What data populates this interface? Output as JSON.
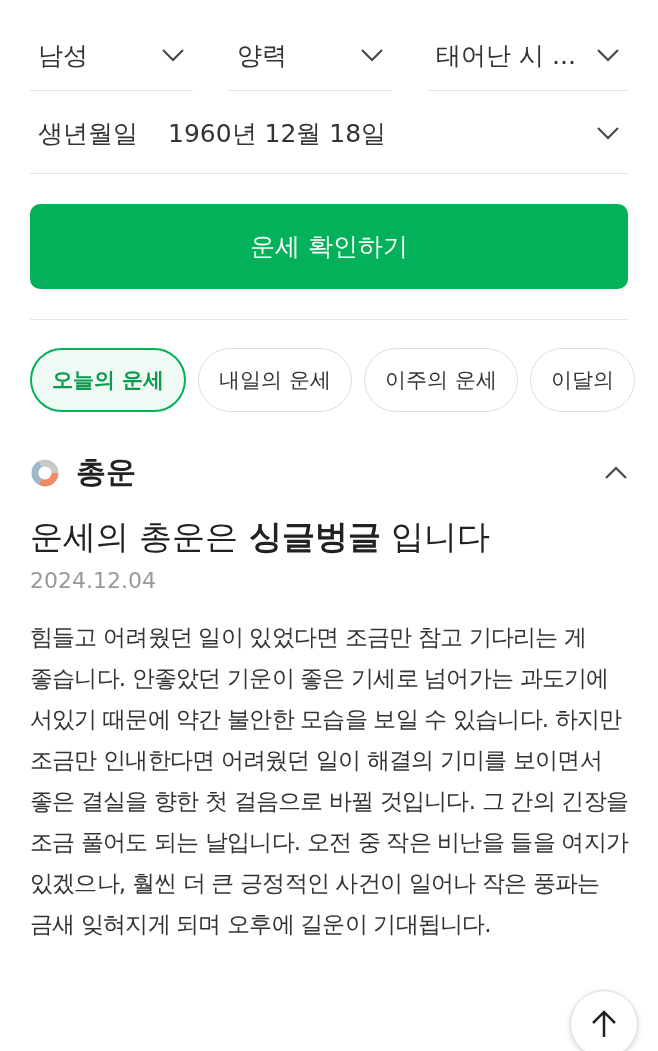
{
  "filters": [
    {
      "label": "남성"
    },
    {
      "label": "양력"
    },
    {
      "label": "태어난 시 ..."
    }
  ],
  "birth_date": {
    "label": "생년월일",
    "value": "1960년 12월 18일"
  },
  "submit_button": "운세 확인하기",
  "tabs": [
    {
      "label": "오늘의 운세",
      "selected": true
    },
    {
      "label": "내일의 운세",
      "selected": false
    },
    {
      "label": "이주의 운세",
      "selected": false
    },
    {
      "label": "이달의",
      "selected": false
    }
  ],
  "section": {
    "title": "총운",
    "expanded": true,
    "headline": "운세의 총운은 **싱글벙글** 입니다",
    "date": "2024.12.04",
    "body": "힘들고 어려웠던 일이 있었다면 조금만 참고 기다리는 게 좋습니다. 안좋았던 기운이 좋은 기세로 넘어가는 과도기에 서있기 때문에 약간 불안한 모습을 보일 수 있습니다. 하지만 조금만 인내한다면 어려웠던 일이 해결의 기미를 보이면서 좋은 결실을 향한 첫 걸음으로 바뀔 것입니다. 그 간의 긴장을 조금 풀어도 되는 날입니다. 오전 중 작은 비난을 들을 여지가 있겠으나, 훨씬 더 큰 긍정적인 사건이 일어나 작은 풍파는 금새 잊혀지게 되며 오후에 길운이 기대됩니다."
  }
}
